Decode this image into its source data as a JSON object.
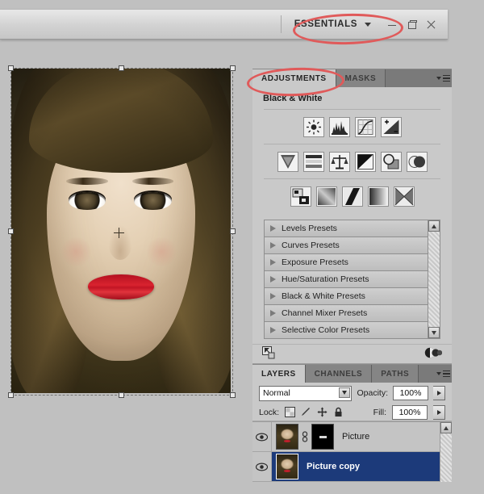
{
  "appbar": {
    "workspace_label": "ESSENTIALS",
    "workspace_caret_icon": "caret-down-icon",
    "window_controls": [
      {
        "name": "minimize",
        "icon": "minimize-icon"
      },
      {
        "name": "restore",
        "icon": "restore-icon"
      },
      {
        "name": "close",
        "icon": "close-icon"
      }
    ]
  },
  "document": {
    "image_alt": "portrait photo of a woman with red lipstick",
    "transform_handles": 8,
    "reference_point_icon": "transform-reference-point-icon"
  },
  "adjustments_panel": {
    "tabs": [
      {
        "label": "ADJUSTMENTS",
        "active": true
      },
      {
        "label": "MASKS",
        "active": false
      }
    ],
    "menu_icon": "panel-menu-icon",
    "title": "Black & White",
    "icon_rows": [
      [
        {
          "name": "brightness-contrast-icon",
          "title": "Brightness/Contrast"
        },
        {
          "name": "levels-icon",
          "title": "Levels"
        },
        {
          "name": "curves-icon",
          "title": "Curves"
        },
        {
          "name": "exposure-icon",
          "title": "Exposure"
        }
      ],
      [
        {
          "name": "vibrance-icon",
          "title": "Vibrance"
        },
        {
          "name": "hue-saturation-icon",
          "title": "Hue/Saturation"
        },
        {
          "name": "color-balance-icon",
          "title": "Color Balance"
        },
        {
          "name": "black-white-icon",
          "title": "Black & White"
        },
        {
          "name": "photo-filter-icon",
          "title": "Photo Filter"
        },
        {
          "name": "channel-mixer-icon",
          "title": "Channel Mixer"
        }
      ],
      [
        {
          "name": "invert-icon",
          "title": "Invert"
        },
        {
          "name": "posterize-icon",
          "title": "Posterize"
        },
        {
          "name": "threshold-icon",
          "title": "Threshold"
        },
        {
          "name": "gradient-map-icon",
          "title": "Gradient Map"
        },
        {
          "name": "selective-color-icon",
          "title": "Selective Color"
        }
      ]
    ],
    "presets": [
      "Levels Presets",
      "Curves Presets",
      "Exposure Presets",
      "Hue/Saturation Presets",
      "Black & White Presets",
      "Channel Mixer Presets",
      "Selective Color Presets"
    ],
    "scroll_up_icon": "scroll-up-arrow-icon",
    "scroll_down_icon": "scroll-down-arrow-icon",
    "footer": {
      "clip_to_layer_icon": "clip-to-layer-icon",
      "adjustment_layer_icon": "adjustment-layer-icon"
    }
  },
  "layers_panel": {
    "tabs": [
      {
        "label": "LAYERS",
        "active": true
      },
      {
        "label": "CHANNELS",
        "active": false
      },
      {
        "label": "PATHS",
        "active": false
      }
    ],
    "menu_icon": "panel-menu-icon",
    "blend_mode": "Normal",
    "opacity_label": "Opacity:",
    "opacity_value": "100%",
    "lock_label": "Lock:",
    "lock_icons": [
      {
        "name": "lock-transparent-pixels-icon"
      },
      {
        "name": "lock-image-pixels-icon"
      },
      {
        "name": "lock-position-icon"
      },
      {
        "name": "lock-all-icon"
      }
    ],
    "fill_label": "Fill:",
    "fill_value": "100%",
    "layers": [
      {
        "name": "Picture",
        "visible": true,
        "selected": false,
        "has_mask": true,
        "linked": true,
        "visibility_icon": "eye-icon",
        "link_icon": "link-icon"
      },
      {
        "name": "Picture copy",
        "visible": true,
        "selected": true,
        "has_mask": false,
        "linked": false,
        "visibility_icon": "eye-icon"
      }
    ]
  },
  "annotations": [
    {
      "name": "annotation-ellipse-essentials",
      "target": "ESSENTIALS",
      "color": "#e05a5a"
    },
    {
      "name": "annotation-ellipse-adjustments",
      "target": "ADJUSTMENTS",
      "color": "#e05a5a"
    }
  ]
}
